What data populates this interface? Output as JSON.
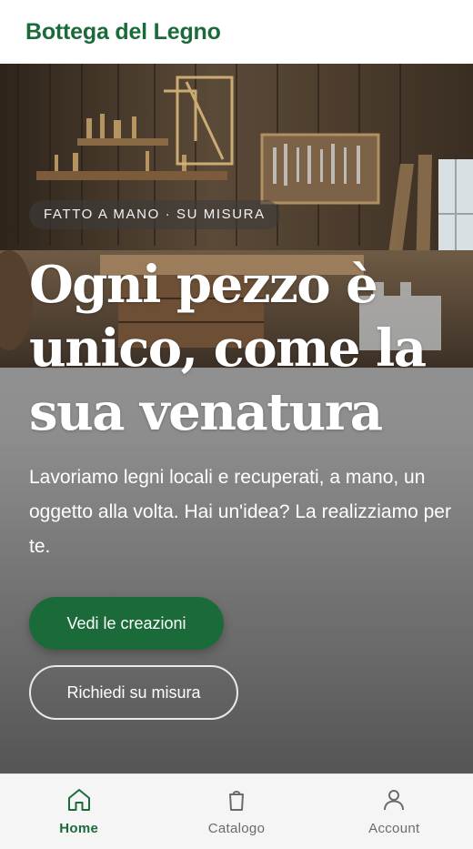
{
  "app": {
    "brand": "Bottega del Legno"
  },
  "hero": {
    "tag": "FATTO A MANO · SU MISURA",
    "headline": "Ogni pezzo è unico, come la sua venatura",
    "lead": "Lavoriamo legni locali e recuperati, a mano, un oggetto alla volta. Hai un'idea? La realizziamo per te.",
    "primary_cta": "Vedi le creazioni",
    "secondary_cta": "Richiedi su misura"
  },
  "tabbar": {
    "items": [
      {
        "label": "Home",
        "icon": "home-icon",
        "active": true
      },
      {
        "label": "Catalogo",
        "icon": "shopping-bag-icon",
        "active": false
      },
      {
        "label": "Account",
        "icon": "user-icon",
        "active": false
      }
    ]
  },
  "colors": {
    "brand_green": "#1b6b3a",
    "tab_inactive": "#6b6b6b",
    "tabbar_bg": "#f5f5f5"
  }
}
